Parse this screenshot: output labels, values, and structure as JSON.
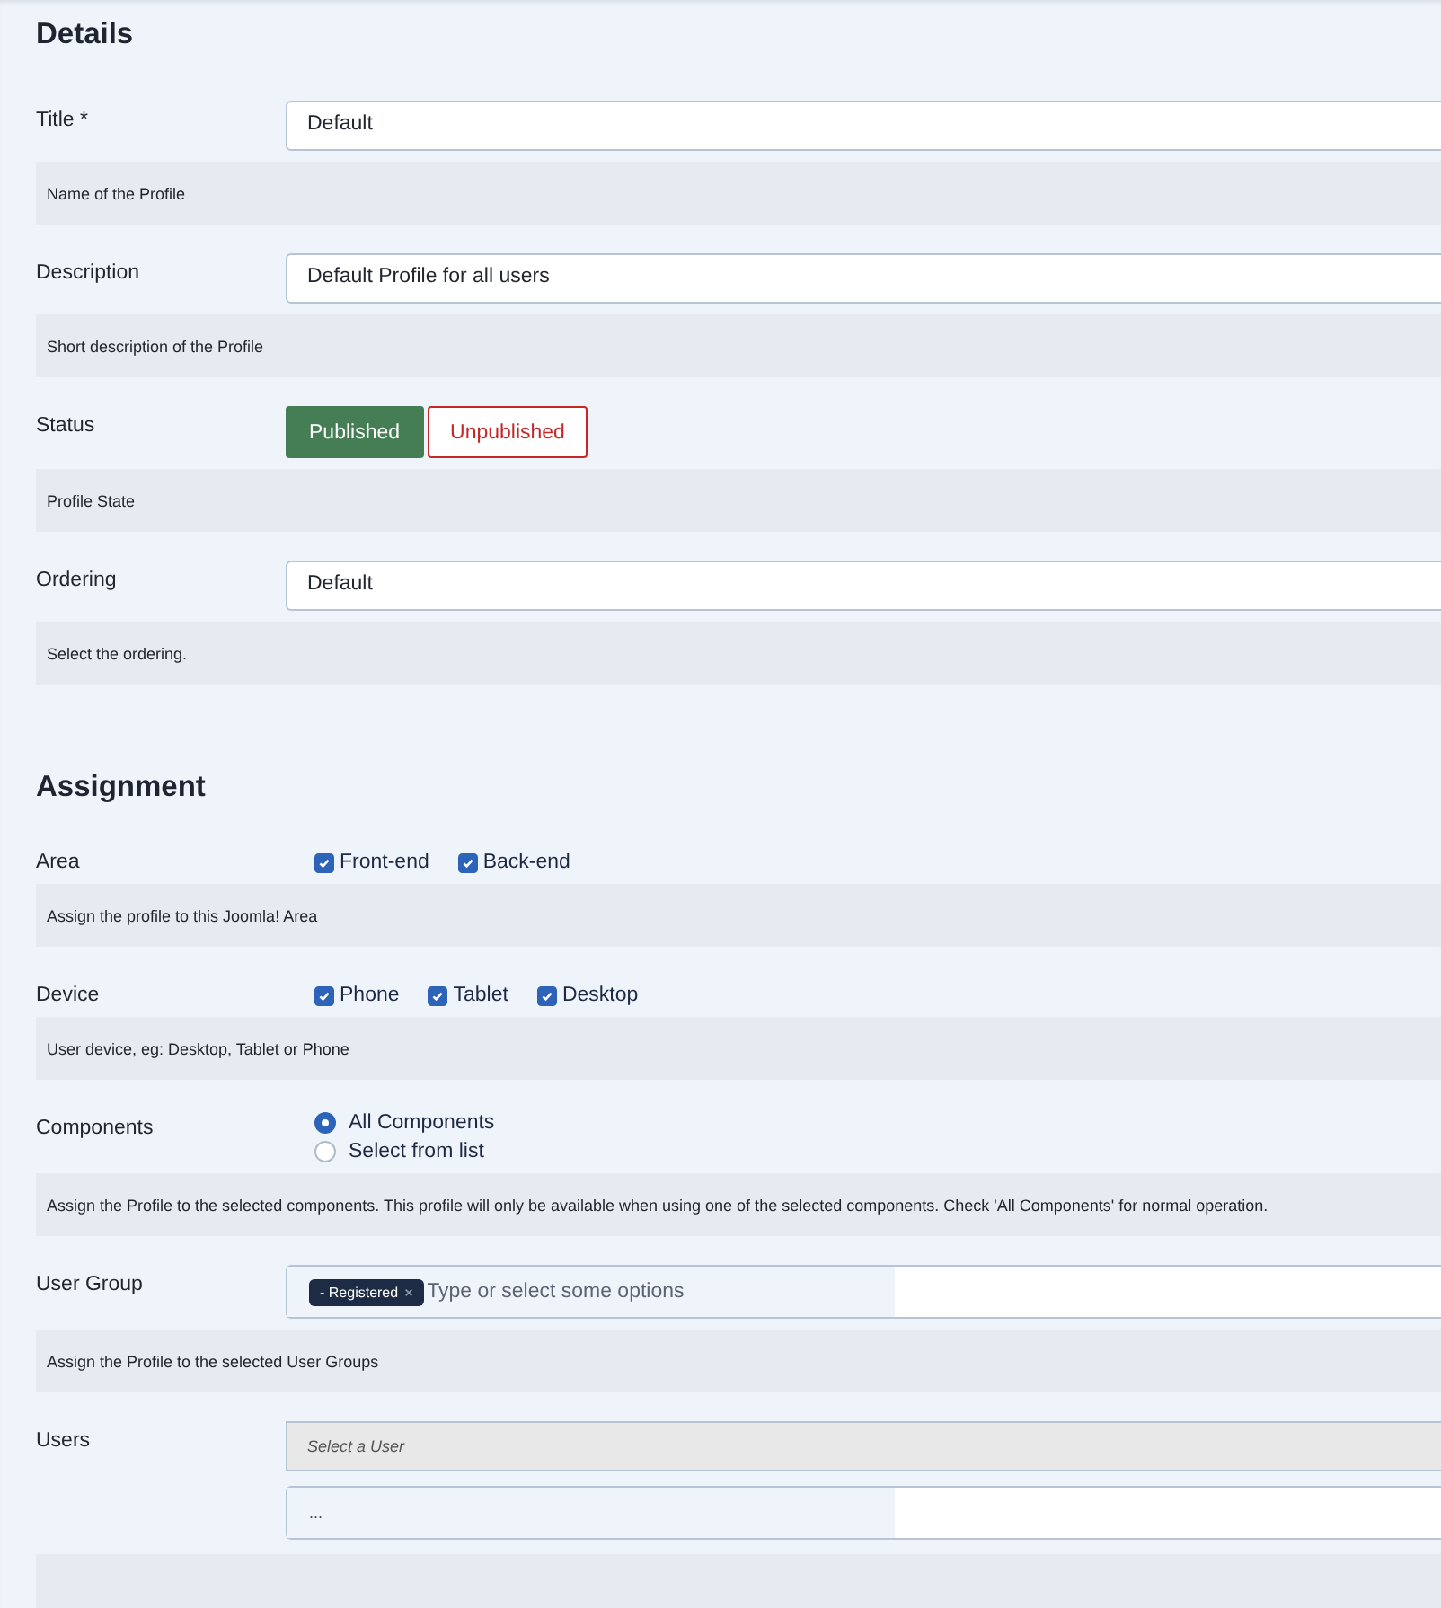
{
  "sections": [
    {
      "title": "Details",
      "fields": [
        {
          "kind": "text",
          "label": "Title *",
          "value": "Default",
          "help": "Name of the Profile"
        },
        {
          "kind": "text",
          "label": "Description",
          "value": "Default Profile for all users",
          "help": "Short description of the Profile"
        },
        {
          "kind": "toggle",
          "label": "Status",
          "options": [
            {
              "label": "Published",
              "selected": true,
              "kind": "success"
            },
            {
              "label": "Unpublished",
              "selected": false,
              "kind": "danger"
            }
          ],
          "help": "Profile State"
        },
        {
          "kind": "text",
          "label": "Ordering",
          "value": "Default",
          "help": "Select the ordering."
        }
      ]
    },
    {
      "title": "Assignment",
      "fields": [
        {
          "kind": "checkboxes",
          "label": "Area",
          "options": [
            {
              "label": "Front-end",
              "checked": true
            },
            {
              "label": "Back-end",
              "checked": true
            }
          ],
          "help": "Assign the profile to this Joomla! Area"
        },
        {
          "kind": "checkboxes",
          "label": "Device",
          "options": [
            {
              "label": "Phone",
              "checked": true
            },
            {
              "label": "Tablet",
              "checked": true
            },
            {
              "label": "Desktop",
              "checked": true
            }
          ],
          "help": "User device, eg: Desktop, Tablet or Phone"
        },
        {
          "kind": "radios",
          "label": "Components",
          "options": [
            {
              "label": "All Components",
              "selected": true
            },
            {
              "label": "Select from list",
              "selected": false
            }
          ],
          "help": "Assign the Profile to the selected components. This profile will only be available when using one of the selected components. Check 'All Components' for normal operation."
        },
        {
          "kind": "tags",
          "label": "User Group",
          "tags": [
            "- Registered"
          ],
          "placeholder": "Type or select some options",
          "help": "Assign the Profile to the selected User Groups"
        },
        {
          "kind": "user",
          "label": "Users",
          "placeholder": "Select a User",
          "value": "..."
        }
      ]
    }
  ]
}
